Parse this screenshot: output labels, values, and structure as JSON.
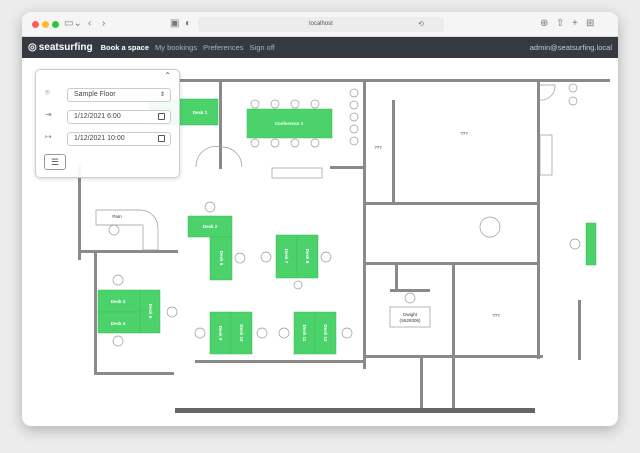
{
  "browser": {
    "url": "localhost"
  },
  "nav": {
    "brand": "seatsurfing",
    "items": [
      "Book a space",
      "My bookings",
      "Preferences",
      "Sign off"
    ],
    "user": "admin@seatsurfing.local"
  },
  "panel": {
    "location": "Sample Floor",
    "enter": "1/12/2021 6:00",
    "leave": "1/12/2021 10:00"
  },
  "floor": {
    "spaces": [
      "Desk 1",
      "Conference 1",
      "Desk 2",
      "Desk 6",
      "Desk 7",
      "Desk 8",
      "Desk 3",
      "Desk 4",
      "Desk 5",
      "Desk 9",
      "Desk 10",
      "Desk 11",
      "Desk 12"
    ],
    "labels": [
      "???",
      "???",
      "???",
      "Pam",
      "Dwight",
      "(S629306)"
    ]
  },
  "colors": {
    "desk": "#4cd26b",
    "navbar": "#343a40",
    "wall": "#8a8a8a"
  }
}
